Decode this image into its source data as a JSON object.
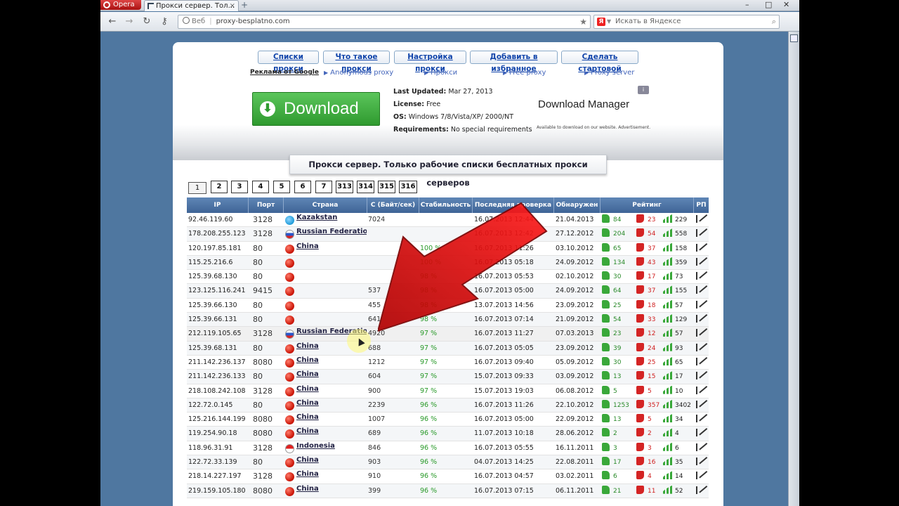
{
  "browser": {
    "menu_label": "Opera",
    "tab_title": "Прокси сервер. Тол...",
    "new_tab": "+",
    "address_prefix": "Веб",
    "address": "proxy-besplatno.com",
    "search_placeholder": "Искать в Яндексе"
  },
  "nav": {
    "links": [
      "Списки прокси",
      "Что такое прокси",
      "Настройка прокси",
      "Добавить в избранное",
      "Сделать стартовой"
    ],
    "google_ads_label": "Реклама от Google",
    "ad_links": [
      "Anonymous proxy",
      "Прокси",
      "Free proxy",
      "Proxy server"
    ]
  },
  "ad": {
    "download_label": "Download",
    "last_updated_label": "Last Updated:",
    "last_updated": "Mar 27, 2013",
    "license_label": "License:",
    "license": "Free",
    "os_label": "OS:",
    "os": "Windows 7/8/Vista/XP/ 2000/NT",
    "requirements_label": "Requirements:",
    "requirements": "No special requirements",
    "product": "Download Manager",
    "note": "Available to download on our website. Advertisement."
  },
  "banner": "Прокси сервер. Только рабочие списки бесплатных прокси серверов",
  "pagination": [
    "1",
    "2",
    "3",
    "4",
    "5",
    "6",
    "7",
    "313",
    "314",
    "315",
    "316"
  ],
  "table": {
    "headers": [
      "IP",
      "Порт",
      "Страна",
      "С (Байт/сек)",
      "Стабильность",
      "Последняя проверка",
      "Обнаружен",
      "Рейтинг",
      "РП"
    ],
    "rows": [
      {
        "ip": "92.46.119.60",
        "port": "3128",
        "flag": "kz",
        "country": "Kazakstan",
        "speed": "7024",
        "stab": "",
        "last": "16.07.2013 12:44",
        "found": "21.04.2013",
        "up": "84",
        "down": "23",
        "rating": "229"
      },
      {
        "ip": "178.208.255.123",
        "port": "3128",
        "flag": "ru",
        "country": "Russian Federation",
        "speed": "",
        "stab": "",
        "last": "16.07.2013 12:42",
        "found": "27.12.2012",
        "up": "204",
        "down": "54",
        "rating": "558"
      },
      {
        "ip": "120.197.85.181",
        "port": "80",
        "flag": "cn",
        "country": "China",
        "speed": "",
        "stab": "100 %",
        "last": "16.07.2013 11:26",
        "found": "03.10.2012",
        "up": "65",
        "down": "37",
        "rating": "158"
      },
      {
        "ip": "115.25.216.6",
        "port": "80",
        "flag": "cn",
        "country": "",
        "speed": "",
        "stab": "100 %",
        "last": "16.07.2013 05:18",
        "found": "24.09.2012",
        "up": "134",
        "down": "43",
        "rating": "359"
      },
      {
        "ip": "125.39.68.130",
        "port": "80",
        "flag": "cn",
        "country": "",
        "speed": "",
        "stab": "98 %",
        "last": "16.07.2013 05:53",
        "found": "02.10.2012",
        "up": "30",
        "down": "17",
        "rating": "73"
      },
      {
        "ip": "123.125.116.241",
        "port": "9415",
        "flag": "cn",
        "country": "",
        "speed": "537",
        "stab": "98 %",
        "last": "16.07.2013 05:00",
        "found": "24.09.2012",
        "up": "64",
        "down": "37",
        "rating": "155"
      },
      {
        "ip": "125.39.66.130",
        "port": "80",
        "flag": "cn",
        "country": "",
        "speed": "455",
        "stab": "98 %",
        "last": "13.07.2013 14:56",
        "found": "23.09.2012",
        "up": "25",
        "down": "18",
        "rating": "57"
      },
      {
        "ip": "125.39.66.131",
        "port": "80",
        "flag": "cn",
        "country": "",
        "speed": "641",
        "stab": "98 %",
        "last": "16.07.2013 07:14",
        "found": "21.09.2012",
        "up": "54",
        "down": "33",
        "rating": "129"
      },
      {
        "ip": "212.119.105.65",
        "port": "3128",
        "flag": "ru",
        "country": "Russian Federation",
        "speed": "4920",
        "stab": "97 %",
        "last": "16.07.2013 11:27",
        "found": "07.03.2013",
        "up": "23",
        "down": "12",
        "rating": "57"
      },
      {
        "ip": "125.39.68.131",
        "port": "80",
        "flag": "cn",
        "country": "China",
        "speed": "688",
        "stab": "97 %",
        "last": "16.07.2013 05:05",
        "found": "23.09.2012",
        "up": "39",
        "down": "24",
        "rating": "93"
      },
      {
        "ip": "211.142.236.137",
        "port": "8080",
        "flag": "cn",
        "country": "China",
        "speed": "1212",
        "stab": "97 %",
        "last": "16.07.2013 09:40",
        "found": "05.09.2012",
        "up": "30",
        "down": "25",
        "rating": "65"
      },
      {
        "ip": "211.142.236.133",
        "port": "80",
        "flag": "cn",
        "country": "China",
        "speed": "604",
        "stab": "97 %",
        "last": "15.07.2013 09:33",
        "found": "03.09.2012",
        "up": "13",
        "down": "15",
        "rating": "17"
      },
      {
        "ip": "218.108.242.108",
        "port": "3128",
        "flag": "cn",
        "country": "China",
        "speed": "900",
        "stab": "97 %",
        "last": "15.07.2013 19:03",
        "found": "06.08.2012",
        "up": "5",
        "down": "5",
        "rating": "10"
      },
      {
        "ip": "122.72.0.145",
        "port": "80",
        "flag": "cn",
        "country": "China",
        "speed": "2239",
        "stab": "96 %",
        "last": "16.07.2013 11:26",
        "found": "22.10.2012",
        "up": "1253",
        "down": "357",
        "rating": "3402"
      },
      {
        "ip": "125.216.144.199",
        "port": "8080",
        "flag": "cn",
        "country": "China",
        "speed": "1007",
        "stab": "96 %",
        "last": "16.07.2013 05:00",
        "found": "22.09.2012",
        "up": "13",
        "down": "5",
        "rating": "34"
      },
      {
        "ip": "119.254.90.18",
        "port": "8080",
        "flag": "cn",
        "country": "China",
        "speed": "689",
        "stab": "96 %",
        "last": "11.07.2013 10:18",
        "found": "28.06.2012",
        "up": "2",
        "down": "2",
        "rating": "4"
      },
      {
        "ip": "118.96.31.91",
        "port": "3128",
        "flag": "id",
        "country": "Indonesia",
        "speed": "846",
        "stab": "96 %",
        "last": "16.07.2013 05:55",
        "found": "16.11.2011",
        "up": "3",
        "down": "3",
        "rating": "6"
      },
      {
        "ip": "122.72.33.139",
        "port": "80",
        "flag": "cn",
        "country": "China",
        "speed": "903",
        "stab": "96 %",
        "last": "04.07.2013 14:25",
        "found": "22.08.2011",
        "up": "17",
        "down": "16",
        "rating": "35"
      },
      {
        "ip": "218.14.227.197",
        "port": "3128",
        "flag": "cn",
        "country": "China",
        "speed": "910",
        "stab": "96 %",
        "last": "16.07.2013 04:57",
        "found": "03.02.2011",
        "up": "6",
        "down": "4",
        "rating": "14"
      },
      {
        "ip": "219.159.105.180",
        "port": "8080",
        "flag": "cn",
        "country": "China",
        "speed": "399",
        "stab": "96 %",
        "last": "16.07.2013 07:15",
        "found": "06.11.2011",
        "up": "21",
        "down": "11",
        "rating": "52"
      }
    ]
  },
  "colors": {
    "header_bg": "#4a70a2",
    "stability_green": "#2a9a2a",
    "negative_red": "#d02020",
    "arrow_red": "#e01010"
  }
}
